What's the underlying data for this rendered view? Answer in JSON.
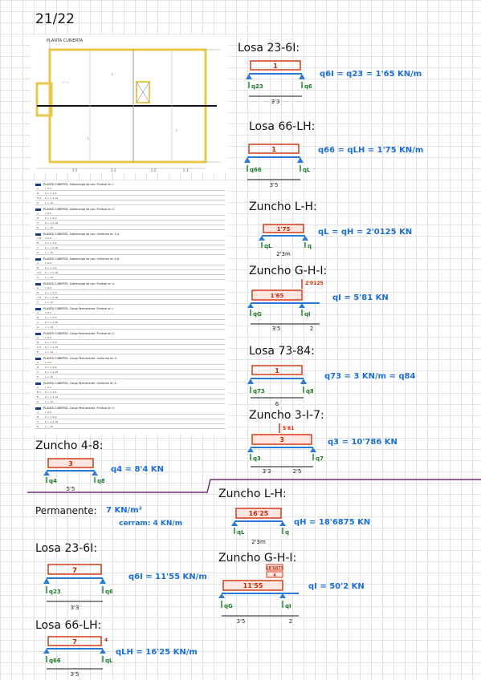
{
  "header": {
    "title": "21/22"
  },
  "plan": {
    "title": "PLANTA CUBIERTA"
  },
  "load_tables": [
    {
      "header": "PLANTA CUBIERTA. Sobrecarga de uso. Puntual en I.",
      "rows": [
        [
          "A",
          "x ≤ 0"
        ],
        [
          "B",
          "0 < x ≤ 6"
        ],
        [
          "C D",
          "6 < x ≤ 16"
        ],
        [
          "E",
          "x > 16"
        ]
      ]
    },
    {
      "header": "PLANTA CUBIERTA. Sobrecarga de uso. Puntual en 2.",
      "rows": [
        [
          "A",
          "x ≤ 0"
        ],
        [
          "B",
          "0 < x ≤ 6"
        ],
        [
          "C",
          "6 < x ≤ 16"
        ],
        [
          "D",
          "x > 16"
        ]
      ]
    },
    {
      "header": "PLANTA CUBIERTA. Sobrecarga de uso. Uniforme en 3-4.",
      "rows": [
        [
          "A B",
          "x ≤ 0"
        ],
        [
          "B",
          "0 < x ≤ 6"
        ],
        [
          "C",
          "6 < x ≤ 16"
        ],
        [
          "D",
          "x > 16"
        ]
      ]
    },
    {
      "header": "PLANTA CUBIERTA. Sobrecarga de uso. Uniforme en 4-8.",
      "rows": [
        [
          "A",
          "x ≤ 0"
        ],
        [
          "B",
          "0 < x ≤ 6"
        ],
        [
          "C D",
          "6 < x ≤ 16"
        ],
        [
          "E",
          "x > 16"
        ]
      ]
    },
    {
      "header": "PLANTA CUBIERTA. Sobrecarga de uso. Puntual en 4.",
      "rows": [
        [
          "A",
          "x ≤ 0"
        ],
        [
          "B",
          "0 < x ≤ 6"
        ],
        [
          "C D",
          "6 < x ≤ 16"
        ],
        [
          "E",
          "x > 16"
        ]
      ]
    },
    {
      "header": "PLANTA CUBIERTA. Carga Permanente. Puntual en I.",
      "rows": [
        [
          "A",
          "x ≤ 0"
        ],
        [
          "B",
          "0 < x ≤ 6"
        ],
        [
          "C",
          "6 < x ≤ 16"
        ],
        [
          "D",
          "x > 16"
        ]
      ]
    },
    {
      "header": "PLANTA CUBIERTA. Carga Permanente. Puntual en 2.",
      "rows": [
        [
          "A",
          "x ≤ 0"
        ],
        [
          "B",
          "0 < x ≤ 6"
        ],
        [
          "C D",
          "6 < x ≤ 16"
        ],
        [
          "E",
          "x > 16"
        ]
      ]
    },
    {
      "header": "PLANTA CUBIERTA. Carga Permanente. Uniforme en 3.",
      "rows": [
        [
          "A",
          "x ≤ 0"
        ],
        [
          "B",
          "0 < x ≤ 6"
        ],
        [
          "C",
          "6 < x ≤ 16"
        ],
        [
          "D",
          "x > 16"
        ]
      ]
    },
    {
      "header": "PLANTA CUBIERTA. Carga Permanente. Uniforme en 4.",
      "rows": [
        [
          "A",
          "x ≤ 0"
        ],
        [
          "B C",
          "0 < x ≤ 6"
        ],
        [
          "D",
          "6 < x ≤ 16"
        ],
        [
          "E",
          "x > 16"
        ]
      ]
    },
    {
      "header": "PLANTA CUBIERTA. Carga Permanente. Puntual en 5.",
      "rows": [
        [
          "A",
          "x ≤ 0"
        ],
        [
          "B",
          "0 < x ≤ 6"
        ],
        [
          "C",
          "6 < x ≤ 16"
        ],
        [
          "D",
          "x > 16"
        ]
      ]
    }
  ],
  "top_right": {
    "losa_23_61": {
      "title": "Losa 23-6I:",
      "load": "1",
      "left": "q23",
      "right": "q6I",
      "span": "3'3",
      "eq": "q6I = q23 = 1'65 KN/m"
    },
    "losa_66_lh": {
      "title": "Losa 66-LH:",
      "load": "1",
      "left": "q66",
      "right": "qLH",
      "span": "3'5",
      "eq": "q66 = qLH = 1'75 KN/m"
    },
    "zuncho_lh": {
      "title": "Zuncho L-H:",
      "load": "1'75",
      "left": "qL",
      "right": "qH",
      "span": "2'3m",
      "eq": "qL = qH = 2'0125 KN"
    },
    "zuncho_gh1": {
      "title": "Zuncho G-H-I:",
      "load": "1'65",
      "point": "2'0125",
      "left": "qG",
      "right": "qI",
      "span_a": "3'5",
      "span_b": "2",
      "eq": "qI = 5'81 KN"
    },
    "losa_73_84": {
      "title": "Losa 73-84:",
      "load": "1",
      "left": "q73",
      "right": "q84",
      "span": "6",
      "eq": "q73 = 3 KN/m = q84"
    },
    "zuncho_3_17": {
      "title": "Zuncho 3-I-7:",
      "load": "3",
      "point": "5'81",
      "left": "q3",
      "right": "q7",
      "span_a": "3'3",
      "span_b": "2'5",
      "eq": "q3 = 10'786 KN"
    }
  },
  "zuncho_4_8": {
    "title": "Zuncho 4-8:",
    "load": "3",
    "left": "q4",
    "right": "q8",
    "span": "5'5",
    "eq": "q4 = 8'4 KN"
  },
  "bottom_left": {
    "permanente": {
      "label": "Permanente:",
      "value": "7 KN/m²",
      "cerram": "cerram: 4 KN/m"
    },
    "losa_23_61": {
      "title": "Losa 23-6I:",
      "load": "7",
      "left": "q23",
      "right": "q6I",
      "span": "3'3",
      "eq": "q6I = 11'55 KN/m"
    },
    "losa_66_lh": {
      "title": "Losa 66-LH:",
      "load": "7",
      "extra": "4",
      "left": "q66",
      "right": "qLH",
      "span": "3'5",
      "eq": "qLH = 16'25 KN/m"
    }
  },
  "bottom_right": {
    "zuncho_lh": {
      "title": "Zuncho L-H:",
      "load": "16'25",
      "left": "qL",
      "right": "qH",
      "span": "2'3m",
      "eq": "qH = 18'6875 KN"
    },
    "zuncho_gh1": {
      "title": "Zuncho G-H-I:",
      "load": "11'55",
      "point": "18'6875",
      "extra": "4",
      "left": "qG",
      "right": "qI",
      "span_a": "3'5",
      "span_b": "2",
      "eq": "qI = 50'2 KN"
    }
  },
  "colors": {
    "accent_blue": "#1a6fd6",
    "beam_blue": "#2a7ad6",
    "load_red": "#d43a1a",
    "support_green": "#1f8a2a",
    "divider_purple": "#7a2a7a",
    "plan_yellow": "#e8c84a"
  }
}
